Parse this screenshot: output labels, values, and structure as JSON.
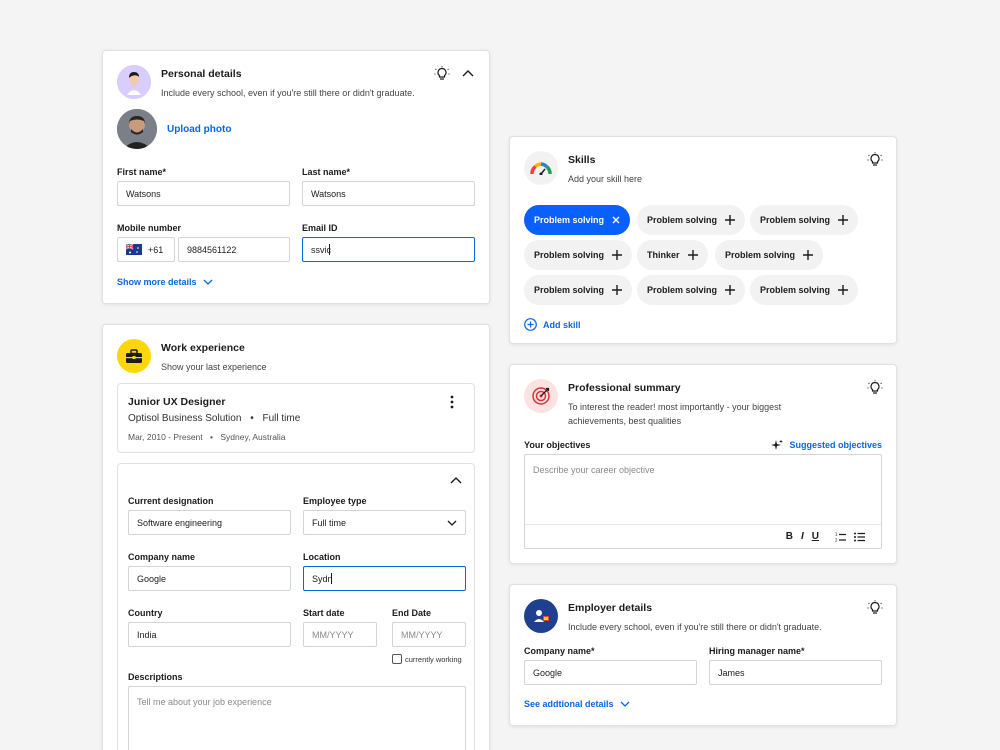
{
  "personal": {
    "title": "Personal details",
    "subtitle": "Include every school, even if you're still there or didn't graduate.",
    "upload_label": "Upload photo",
    "first_name_label": "First name*",
    "first_name_value": "Watsons",
    "last_name_label": "Last name*",
    "last_name_value": "Watsons",
    "mobile_label": "Mobile number",
    "country_code": "+61",
    "mobile_value": "9884561122",
    "email_label": "Email ID",
    "email_value": "ssvic",
    "show_more": "Show more details"
  },
  "work": {
    "title": "Work experience",
    "subtitle": "Show your last experience",
    "job": {
      "title": "Junior UX Designer",
      "company": "Optisol Business Solution",
      "type": "Full time",
      "dates": "Mar, 2010 - Present",
      "location": "Sydney, Australia"
    },
    "designation_label": "Current designation",
    "designation_value": "Software engineering",
    "employee_type_label": "Employee type",
    "employee_type_value": "Full time",
    "company_label": "Company name",
    "company_value": "Google",
    "location_label": "Location",
    "location_value": "Sydn",
    "country_label": "Country",
    "country_value": "India",
    "start_label": "Start date",
    "start_placeholder": "MM/YYYY",
    "end_label": "End Date",
    "end_placeholder": "MM/YYYY",
    "currently_working": "currently working",
    "desc_label": "Descriptions",
    "desc_placeholder": "Tell me about your job experience"
  },
  "skills": {
    "title": "Skills",
    "subtitle": "Add your skill here",
    "chips": [
      {
        "label": "Problem solving",
        "active": true
      },
      {
        "label": "Problem solving",
        "active": false
      },
      {
        "label": "Problem solving",
        "active": false
      },
      {
        "label": "Problem solving",
        "active": false
      },
      {
        "label": "Thinker",
        "active": false
      },
      {
        "label": "Problem solving",
        "active": false
      },
      {
        "label": "Problem solving",
        "active": false
      },
      {
        "label": "Problem solving",
        "active": false
      },
      {
        "label": "Problem solving",
        "active": false
      }
    ],
    "add_skill": "Add skill"
  },
  "summary": {
    "title": "Professional summary",
    "subtitle": "To interest the reader! most importantly - your biggest achievements, best qualities",
    "objectives_label": "Your objectives",
    "suggested": "Suggested objectives",
    "objective_placeholder": "Describe your career objective"
  },
  "employer": {
    "title": "Employer details",
    "subtitle": "Include every school, even if you're still there or didn't graduate.",
    "company_label": "Company name*",
    "company_value": "Google",
    "manager_label": "Hiring manager name*",
    "manager_value": "James",
    "see_more": "See addtional details"
  },
  "colors": {
    "accent": "#0a66e0",
    "chip_active": "#0a5fff",
    "work_badge": "#ffd60a",
    "summary_badge": "#fde2e2",
    "employer_badge": "#1f3f8f"
  }
}
